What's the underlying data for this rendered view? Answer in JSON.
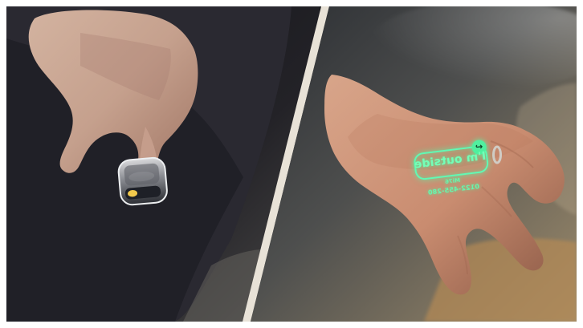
{
  "image": {
    "projection": {
      "message": "I'm outside",
      "label": "Mi76",
      "phone_number": "0122-455-280",
      "icon": "reply-icon"
    },
    "colors": {
      "glow": "#5cffb7",
      "device_accent": "#f2c94c",
      "divider": "#e8e2d7"
    }
  }
}
